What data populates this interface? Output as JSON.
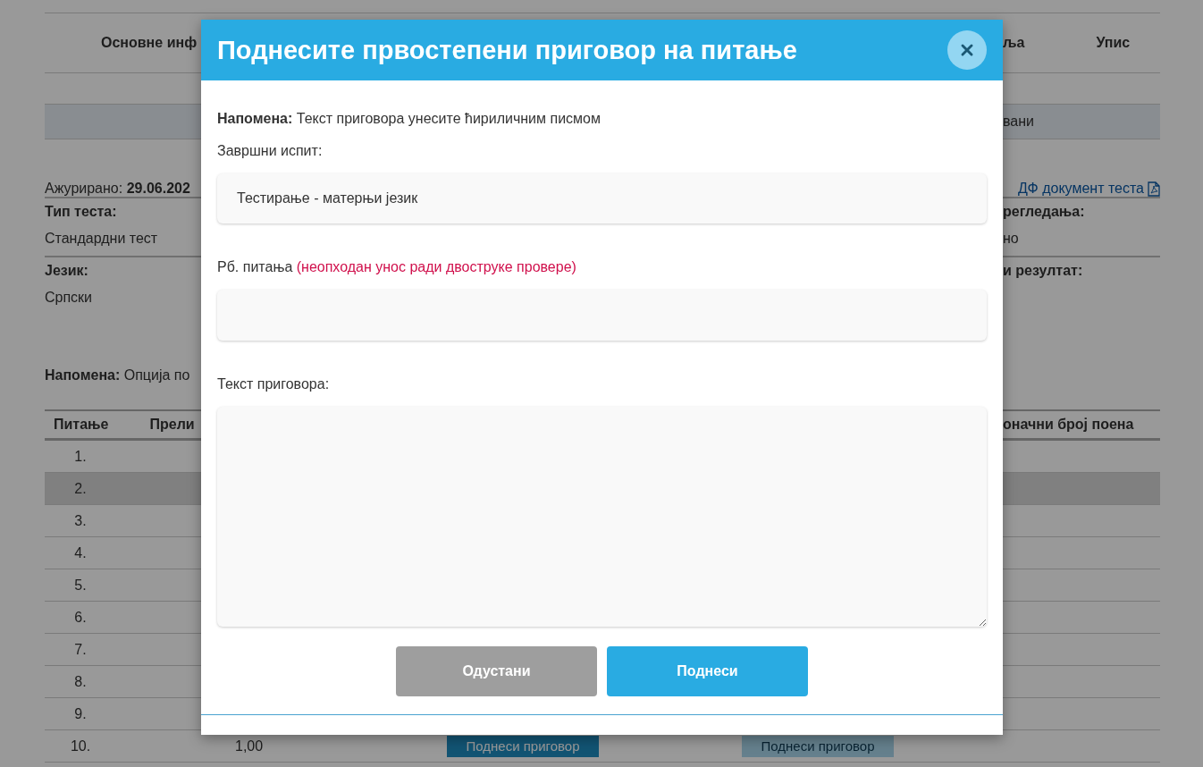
{
  "background": {
    "nav": {
      "left": "Основне инф",
      "right": [
        "ља",
        "Упис"
      ]
    },
    "tab_band": {
      "right": "вани"
    },
    "updated": "Ажурирано: **29.06.202**",
    "pdf_link": "ДФ документ теста",
    "info_rows": [
      {
        "label_left": "Тип теста:",
        "value_left": "Стандардни тест",
        "label_right": "регледања:",
        "value_right": "но"
      },
      {
        "label_left": "Језик:",
        "value_left": "Српски",
        "label_right": "и резултат:"
      }
    ],
    "note": "**Напомена:** Опција по",
    "table": {
      "columns_left": [
        "Питање",
        "Прели"
      ],
      "column_right": "оначни број поена",
      "rows": [
        {
          "number": "1.",
          "shaded": false
        },
        {
          "number": "2.",
          "shaded": true
        },
        {
          "number": "3.",
          "shaded": false
        },
        {
          "number": "4.",
          "shaded": false
        },
        {
          "number": "5.",
          "shaded": false
        },
        {
          "number": "6.",
          "shaded": false
        },
        {
          "number": "7.",
          "shaded": false
        },
        {
          "number": "8.",
          "shaded": false
        },
        {
          "number": "9.",
          "shaded": false
        }
      ],
      "last_row": {
        "number": "10.",
        "points": "1,00",
        "buttons": [
          {
            "label": "Поднеси приговор",
            "disabled": false
          },
          {
            "label": "Поднеси приговор",
            "disabled": true
          }
        ]
      }
    }
  },
  "dialog": {
    "title": "Поднесите првостепени приговор на питање",
    "note": "**Напомена:** Текст приговора унесите ћириличним писмом",
    "fields": [
      {
        "kind": "readonly",
        "label": "Завршни испит:",
        "value": "Тестирање - матерњи језик"
      },
      {
        "kind": "input",
        "label": "Рб. питања",
        "hint": "(неопходан унос ради двоструке провере)"
      },
      {
        "kind": "textarea",
        "label": "Текст приговора:"
      }
    ],
    "buttons": [
      {
        "label": "Одустани",
        "kind": "cancel"
      },
      {
        "label": "Поднеси",
        "kind": "submit"
      }
    ]
  }
}
